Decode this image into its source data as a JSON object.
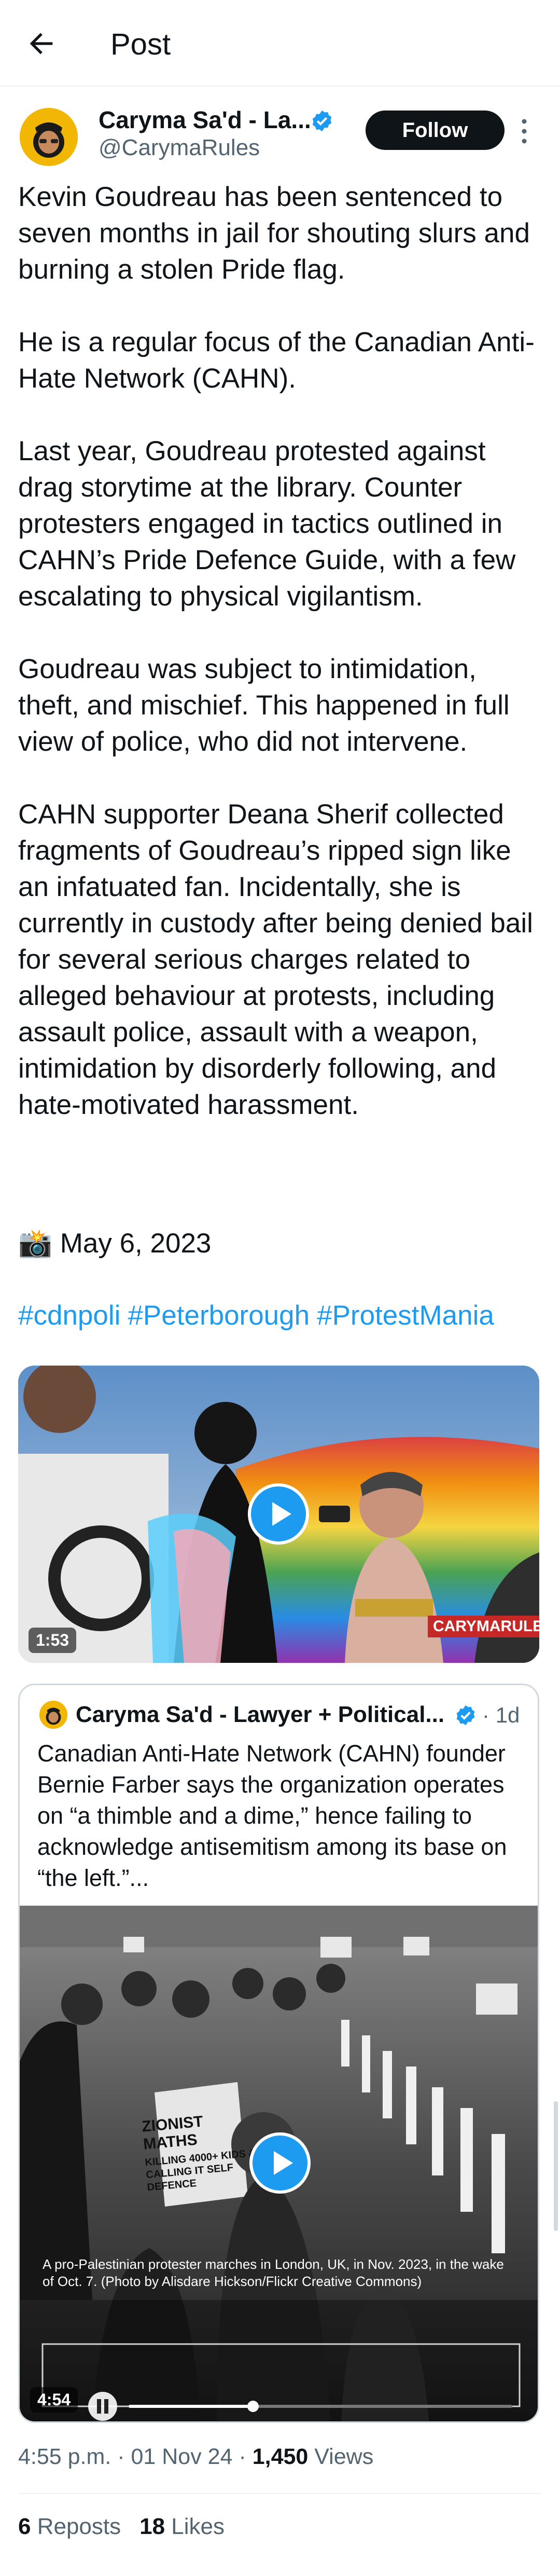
{
  "header": {
    "title": "Post"
  },
  "author": {
    "name": "Caryma Sa'd - La...",
    "handle": "@CarymaRules",
    "follow_label": "Follow"
  },
  "post": {
    "paragraphs": [
      "Kevin Goudreau has been sentenced to seven months in jail for shouting slurs and burning a stolen Pride flag.",
      "He is a regular focus of the Canadian Anti-Hate Network (CAHN).",
      "Last year, Goudreau protested against drag storytime at the library. Counter protesters engaged in tactics outlined in CAHN’s Pride Defence Guide, with a few escalating to physical vigilantism.",
      "Goudreau was subject to intimidation, theft, and mischief. This happened in full view of police, who did not intervene.",
      "CAHN supporter Deana Sherif collected fragments of Goudreau’s ripped sign like an infatuated fan. Incidentally, she is currently in custody after being denied bail for several serious charges related to alleged behaviour at protests, including assault police, assault with a weapon, intimidation by disorderly following, and hate-motivated harassment."
    ],
    "date_line": "📸 May 6, 2023",
    "hashtags": [
      "#cdnpoli",
      "#Peterborough",
      "#ProtestMania"
    ],
    "video": {
      "duration": "1:53",
      "watermark": "CARYMARULES"
    }
  },
  "quote": {
    "name": "Caryma Sa'd - Lawyer + Political...",
    "time": "· 1d",
    "text": "Canadian Anti-Hate Network (CAHN) founder Bernie Farber says the organization operates on “a thimble and a dime,” hence failing to acknowledge antisemitism among its base on “the left.”...",
    "video": {
      "duration": "4:54",
      "caption": "A pro-Palestinian protester marches in London, UK, in Nov. 2023, in the wake of Oct. 7. (Photo by Alisdare Hickson/Flickr Creative Commons)",
      "sign_text": "ZIONIST MATHS",
      "sign_text_2": "KILLING 4000+ KIDS & CALLING IT SELF DEFENCE"
    }
  },
  "meta": {
    "time": "4:55 p.m. · 01 Nov 24 · ",
    "views_count": "1,450",
    "views_label": " Views"
  },
  "stats": {
    "reposts_count": "6",
    "reposts_label": " Reposts",
    "likes_count": "18",
    "likes_label": " Likes"
  },
  "colors": {
    "link": "#1d9bf0",
    "verified": "#1d9bf0",
    "secondary": "#536471",
    "follow_bg": "#0f1419"
  }
}
